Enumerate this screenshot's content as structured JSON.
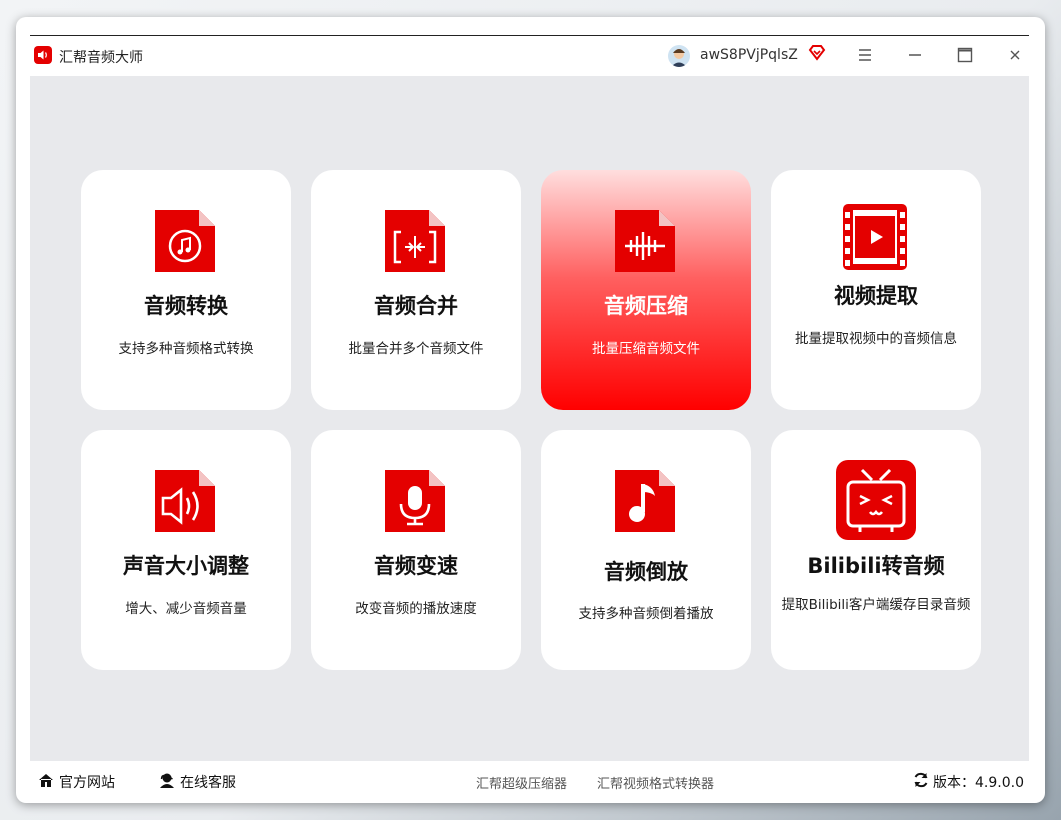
{
  "app": {
    "title": "汇帮音频大师"
  },
  "user": {
    "name": "awS8PVjPqlsZ"
  },
  "cards": [
    {
      "title": "音频转换",
      "desc": "支持多种音频格式转换"
    },
    {
      "title": "音频合并",
      "desc": "批量合并多个音频文件"
    },
    {
      "title": "音频压缩",
      "desc": "批量压缩音频文件"
    },
    {
      "title": "视频提取",
      "desc": "批量提取视频中的音频信息"
    },
    {
      "title": "声音大小调整",
      "desc": "增大、减少音频音量"
    },
    {
      "title": "音频变速",
      "desc": "改变音频的播放速度"
    },
    {
      "title": "音频倒放",
      "desc": "支持多种音频倒着播放"
    },
    {
      "title": "Bilibili转音频",
      "desc": "提取Bilibili客户端缓存目录音频"
    }
  ],
  "footer": {
    "website": "官方网站",
    "support": "在线客服",
    "link1": "汇帮超级压缩器",
    "link2": "汇帮视频格式转换器",
    "version": "版本：4.9.0.0"
  },
  "colors": {
    "accent": "#e40000"
  }
}
